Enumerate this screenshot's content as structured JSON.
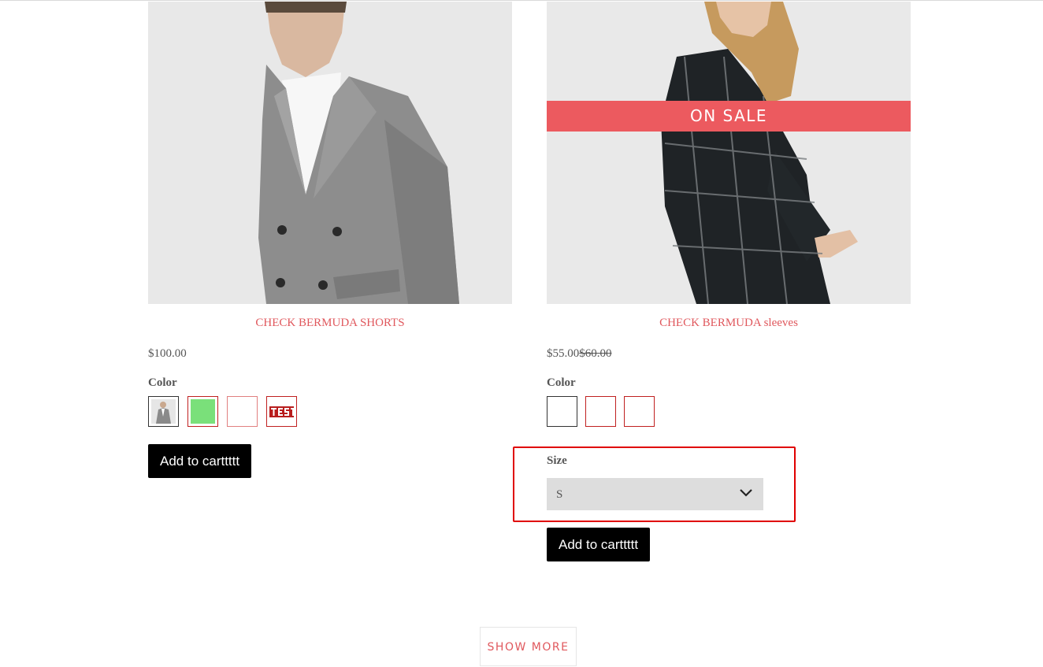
{
  "products": [
    {
      "title": "CHECK BERMUDA SHORTS",
      "price": "$100.00",
      "color_label": "Color",
      "swatches": [
        "model-thumbnail",
        "green",
        "white",
        "test-image"
      ],
      "swatch_colors": {
        "green": "#7ae07a"
      },
      "add_to_cart": "Add to carttttt"
    },
    {
      "badge": "ON SALE",
      "title": "CHECK BERMUDA sleeves",
      "price": "$55.00",
      "old_price": "$60.00",
      "color_label": "Color",
      "swatches": [
        "white",
        "white",
        "white"
      ],
      "size_label": "Size",
      "size_selected": "S",
      "add_to_cart": "Add to carttttt"
    }
  ],
  "show_more": "SHOW MORE",
  "colors": {
    "accent": "#e0585d",
    "sale_banner": "#ec5a5f",
    "highlight_box": "#e00000",
    "button": "#000000"
  }
}
